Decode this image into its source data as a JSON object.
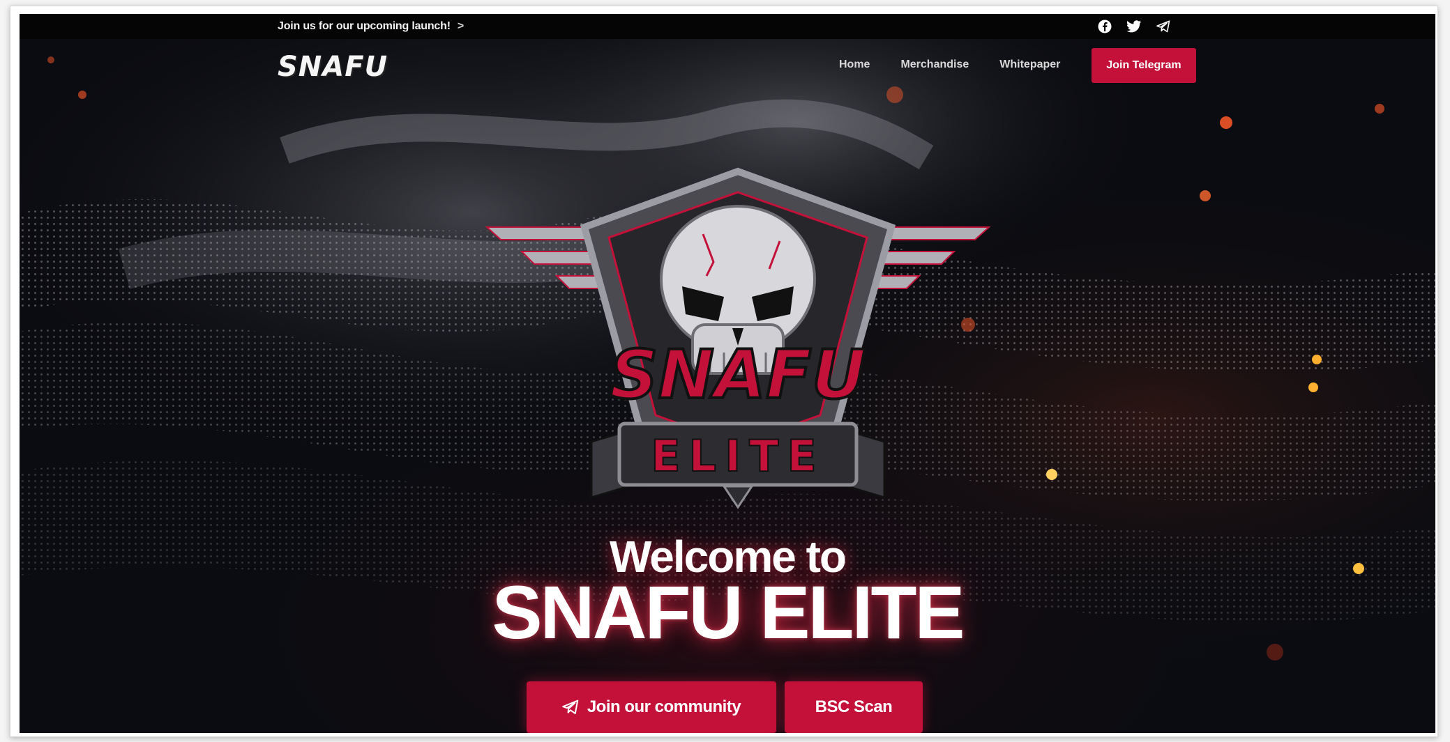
{
  "topbar": {
    "announcement": "Join us for our upcoming launch!",
    "announcement_chevron": ">",
    "social_icons": [
      "facebook-icon",
      "twitter-icon",
      "telegram-icon"
    ]
  },
  "header": {
    "logo_text": "SNAFU",
    "nav": [
      {
        "label": "Home"
      },
      {
        "label": "Merchandise"
      },
      {
        "label": "Whitepaper"
      }
    ],
    "cta_label": "Join Telegram"
  },
  "emblem": {
    "top_word": "SNAFU",
    "banner_word": "ELITE"
  },
  "hero": {
    "welcome": "Welcome to",
    "title": "SNAFU ELITE"
  },
  "buttons": {
    "community_label": "Join our community",
    "community_icon": "telegram-icon",
    "bsc_label": "BSC Scan"
  },
  "colors": {
    "accent": "#c4113a",
    "background": "#0b0c11",
    "topbar": "#050505",
    "text": "#ffffff"
  }
}
